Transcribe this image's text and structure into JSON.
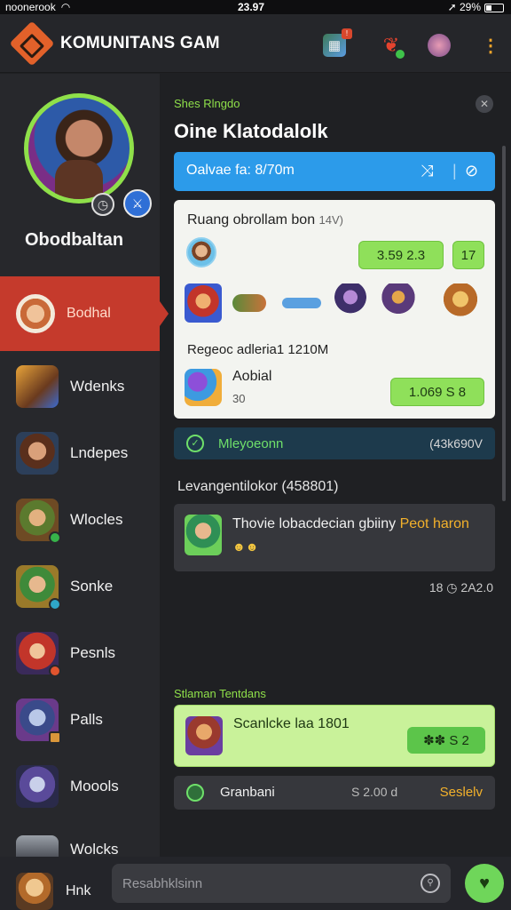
{
  "statusbar": {
    "carrier": "noonerook",
    "time": "23.97",
    "battery": "29%"
  },
  "header": {
    "title": "KOMUNITANS GAM",
    "icons": [
      "map-icon",
      "signal-icon",
      "character-icon",
      "more-icon"
    ],
    "badge": "!"
  },
  "sidebar": {
    "username": "Obodbaltan",
    "items": [
      {
        "label": "Bodhal",
        "icon": "shiba-avatar-icon"
      },
      {
        "label": "Wdenks",
        "icon": "warrior-avatar-icon"
      },
      {
        "label": "Lndepes",
        "icon": "hooded-avatar-icon"
      },
      {
        "label": "Wlocles",
        "icon": "ranger-avatar-icon"
      },
      {
        "label": "Sonke",
        "icon": "elf-avatar-icon"
      },
      {
        "label": "Pesnls",
        "icon": "fire-mage-avatar-icon"
      },
      {
        "label": "Palls",
        "icon": "knight-avatar-icon"
      },
      {
        "label": "Moools",
        "icon": "sorceress-avatar-icon"
      },
      {
        "label": "Wolcks",
        "icon": "armored-avatar-icon"
      }
    ]
  },
  "main": {
    "section_label": "Shes Rlngdo",
    "headline": "Oine Klatodalolk",
    "online_bar": "Oalvae fa: 8/70m",
    "card": {
      "title": "Ruang obrollam bon",
      "title_muted": "14V)",
      "pill1": "3.59  2.3",
      "pill2": "17",
      "subtitle": "Regeoc adleria1 1210M",
      "name": "Aobial",
      "sub": "30",
      "pill3": "1.069   S 8"
    },
    "status": {
      "text": "Mleyoeonn",
      "right": "(43k690V"
    },
    "section2": "Levangentilokor (458801)",
    "message": {
      "text": "Thovie lobacdecian gbiiny",
      "highlight": "Peot haron",
      "emoji": "☻☻"
    },
    "meta": "18  ◷  2A2.0",
    "section3": "Stlaman Tentdans",
    "green_card": {
      "text": "Scanlcke laa 1801",
      "pill": "✽✽   S 2"
    },
    "footrow": {
      "label": "Granbani",
      "num": "S    2.00  d",
      "status": "Seslelv"
    }
  },
  "bottom": {
    "nav_label": "Hnk",
    "search_placeholder": "Resabhklsinn"
  },
  "colors": {
    "accent_green": "#8fe04a",
    "active_red": "#c53a2c",
    "blue_bar": "#2c9bea",
    "orange": "#f3b12b"
  }
}
